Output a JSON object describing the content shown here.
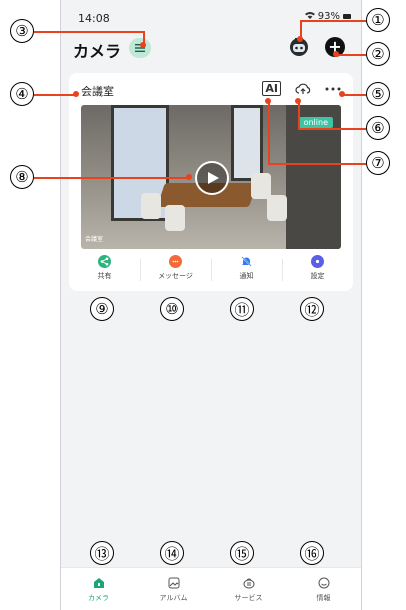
{
  "status_bar": {
    "time": "14:08",
    "battery": "93%"
  },
  "header": {
    "title": "カメラ",
    "menu_icon": "menu-lines-icon",
    "avatar_icon": "robot-avatar-icon",
    "add_icon": "plus-icon",
    "add_label": "+"
  },
  "camera_card": {
    "room_name": "会議室",
    "ai_label": "AI",
    "online_badge": "online",
    "video_overlay_label": "会議室",
    "actions": [
      {
        "label": "共有",
        "icon": "share-icon",
        "color": "#2db37c"
      },
      {
        "label": "メッセージ",
        "icon": "message-icon",
        "color": "#f26b3a"
      },
      {
        "label": "通知",
        "icon": "bell-off-icon",
        "color": "#2f7cf6"
      },
      {
        "label": "設定",
        "icon": "gear-icon",
        "color": "#5b5fe8"
      }
    ]
  },
  "tabbar": {
    "tabs": [
      {
        "label": "カメラ",
        "icon": "camera-home-icon",
        "active": true
      },
      {
        "label": "アルバム",
        "icon": "album-icon",
        "active": false
      },
      {
        "label": "サービス",
        "icon": "service-icon",
        "active": false
      },
      {
        "label": "情報",
        "icon": "smile-icon",
        "active": false
      }
    ]
  },
  "callouts": [
    "①",
    "②",
    "③",
    "④",
    "⑤",
    "⑥",
    "⑦",
    "⑧",
    "⑨",
    "⑩",
    "⑪",
    "⑫",
    "⑬",
    "⑭",
    "⑮",
    "⑯"
  ],
  "colors": {
    "accent": "#1aa678",
    "leader": "#e8431c",
    "online": "#3fc3a5"
  }
}
